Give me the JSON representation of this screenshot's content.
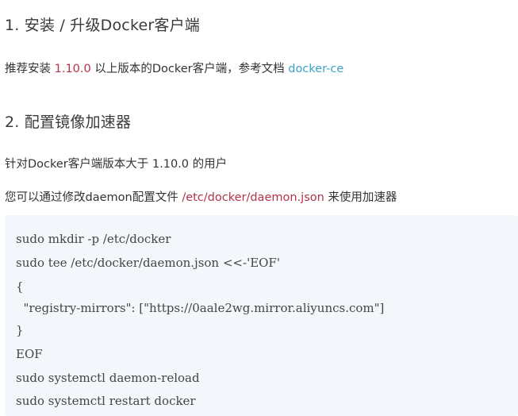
{
  "section1": {
    "heading": "1. 安装 / 升级Docker客户端",
    "para": {
      "prefix": "推荐安装 ",
      "version": "1.10.0",
      "middle": " 以上版本的Docker客户端，参考文档 ",
      "link": "docker-ce"
    }
  },
  "section2": {
    "heading": "2. 配置镜像加速器",
    "para1": "针对Docker客户端版本大于 1.10.0 的用户",
    "para2": {
      "prefix": "您可以通过修改daemon配置文件 ",
      "path": "/etc/docker/daemon.json",
      "suffix": " 来使用加速器"
    }
  },
  "code": {
    "lines": [
      "sudo mkdir -p /etc/docker",
      "sudo tee /etc/docker/daemon.json <<-'EOF'",
      "{",
      "  \"registry-mirrors\": [\"https://0aale2wg.mirror.aliyuncs.com\"]",
      "}",
      "EOF",
      "sudo systemctl daemon-reload",
      "sudo systemctl restart docker"
    ]
  },
  "colors": {
    "accent_red": "#b3334a",
    "link_blue": "#3aa3c9",
    "code_bg": "#f3f6fb"
  }
}
